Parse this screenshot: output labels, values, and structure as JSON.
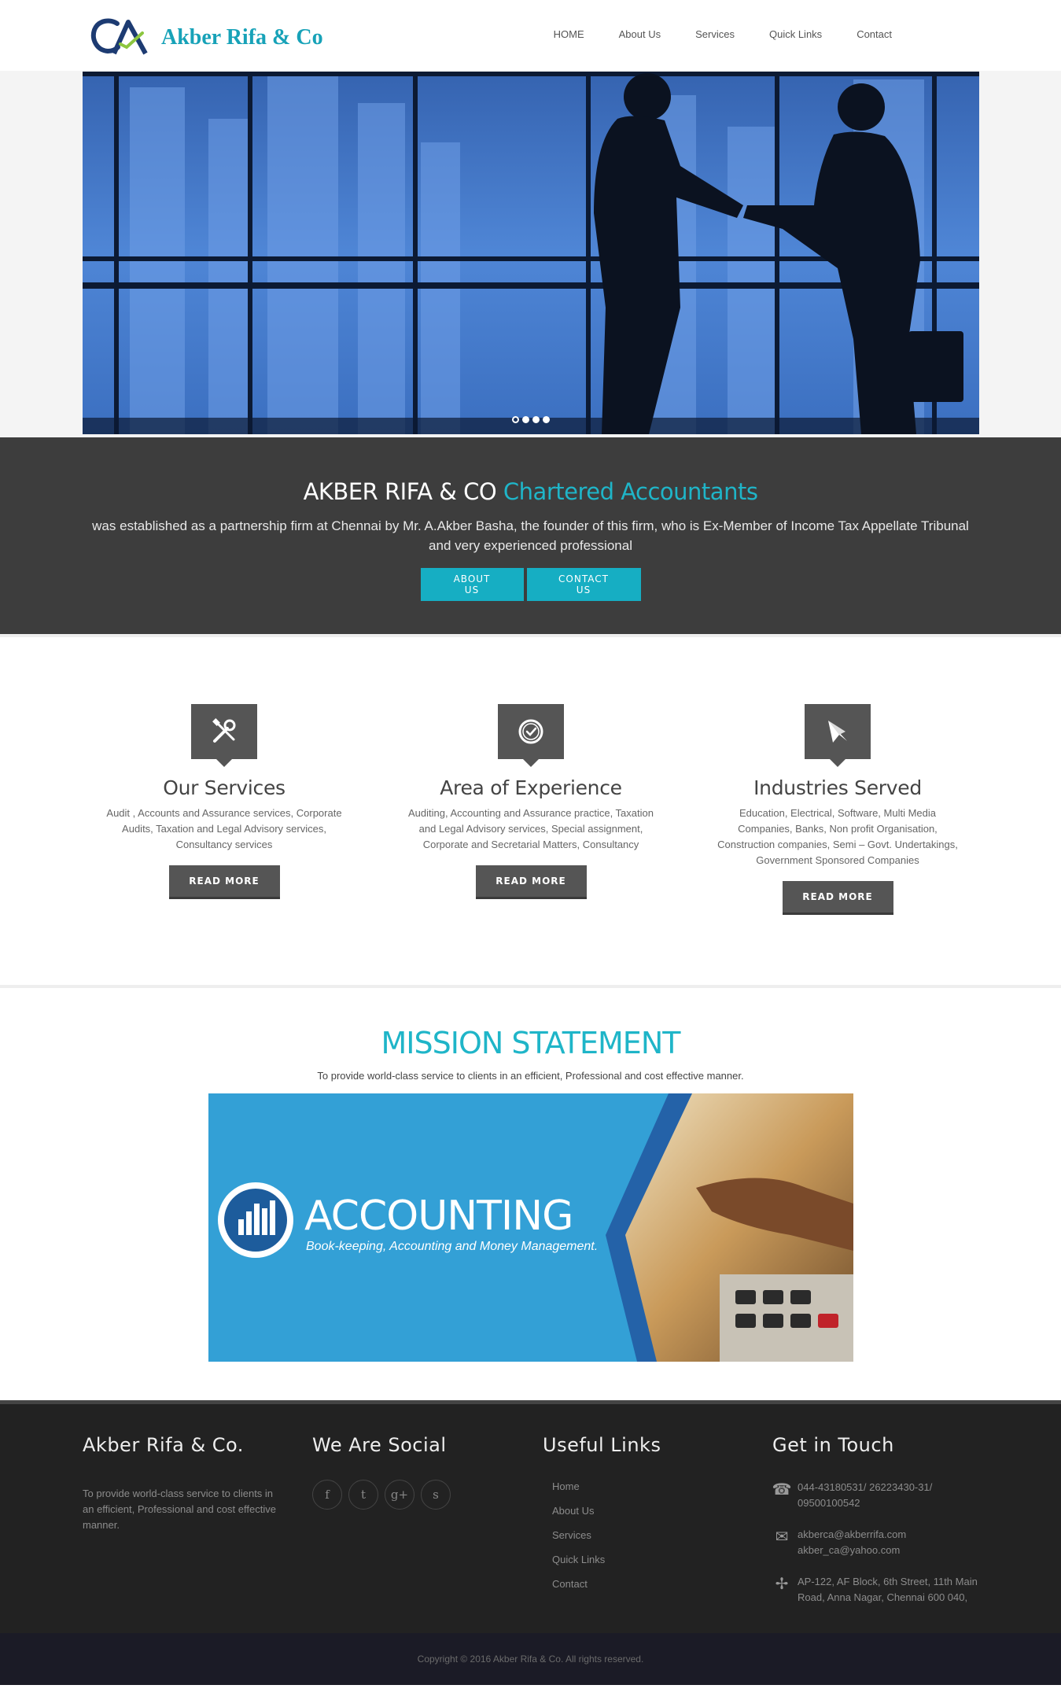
{
  "header": {
    "brand": "Akber Rifa & Co",
    "nav": [
      "HOME",
      "About Us",
      "Services",
      "Quick Links",
      "Contact"
    ]
  },
  "hero": {
    "slides_count": 4,
    "active_slide": 1
  },
  "intro": {
    "title": "AKBER RIFA & CO",
    "title_accent": "Chartered Accountants",
    "text": "was established as a partnership firm at Chennai by Mr. A.Akber Basha, the founder of this firm, who is Ex-Member of Income Tax Appellate Tribunal and very experienced professional",
    "about_button": "ABOUT US",
    "contact_button": "CONTACT US"
  },
  "services": [
    {
      "icon": "tools-icon",
      "title": "Our Services",
      "text": "Audit , Accounts and Assurance services, Corporate Audits, Taxation and Legal Advisory services, Consultancy services",
      "button": "READ MORE"
    },
    {
      "icon": "clock-icon",
      "title": "Area of Experience",
      "text": "Auditing, Accounting and Assurance practice, Taxation and Legal Advisory services, Special assignment, Corporate and Secretarial Matters, Consultancy",
      "button": "READ MORE"
    },
    {
      "icon": "paper-plane-icon",
      "title": "Industries Served",
      "text": "Education, Electrical, Software, Multi Media Companies, Banks, Non profit Organisation, Construction companies, Semi – Govt. Undertakings, Government Sponsored Companies",
      "button": "READ MORE"
    }
  ],
  "mission": {
    "title": "MISSION STATEMENT",
    "text": "To provide world-class service to clients in an efficient, Professional and cost effective manner.",
    "banner_title": "ACCOUNTING",
    "banner_subtitle": "Book-keeping, Accounting and Money Management."
  },
  "footer": {
    "about_title": "Akber Rifa & Co.",
    "about_text": "To provide world-class service to clients in an efficient, Professional and cost effective manner.",
    "social_title": "We Are Social",
    "social_icons": [
      "f",
      "t",
      "g+",
      "s"
    ],
    "links_title": "Useful Links",
    "links": [
      "Home",
      "About Us",
      "Services",
      "Quick Links",
      "Contact"
    ],
    "contact_title": "Get in Touch",
    "phone": "044-43180531/ 26223430-31/ 09500100542",
    "email_1": "akberca@akberrifa.com",
    "email_2": "akber_ca@yahoo.com",
    "address": "AP-122, AF Block, 6th Street, 11th Main Road, Anna Nagar, Chennai 600 040,"
  },
  "copyright": "Copyright © 2016 Akber Rifa & Co. All rights reserved.",
  "colors": {
    "accent": "#16aec3",
    "intro_bg": "#3d3d3d",
    "footer_bg": "#222222",
    "icon_box": "#555555"
  }
}
